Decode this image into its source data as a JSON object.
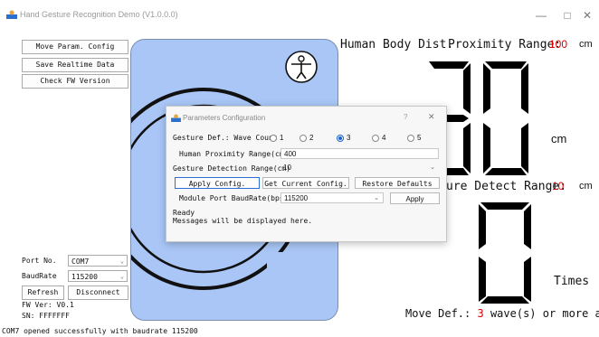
{
  "window": {
    "title": "Hand Gesture Recognition Demo (V1.0.0.0)",
    "minimize": "—",
    "maximize": "□",
    "close": "✕"
  },
  "left_panel": {
    "move_param_config": "Move Param. Config",
    "save_realtime_data": "Save Realtime Data",
    "check_fw_version": "Check FW Version",
    "port_label": "Port No.",
    "port_value": "COM7",
    "baud_label": "BaudRate",
    "baud_value": "115200",
    "refresh": "Refresh",
    "disconnect": "Disconnect",
    "fw_ver": "FW Ver: V0.1",
    "sn": "SN: FFFFFFF"
  },
  "right_panel": {
    "body_dist_label": "Human Body Dist.",
    "proximity_label": "Proximity Range:",
    "proximity_value": "100",
    "proximity_unit": "cm",
    "distance_value": "30",
    "distance_unit": "cm",
    "gesture_detect_label": "ure Detect Range:",
    "gesture_detect_value": "10",
    "gesture_detect_unit": "cm",
    "count_value": "0",
    "count_unit": "Times",
    "move_def_prefix": "Move Def.:",
    "move_def_value": "3",
    "move_def_suffix": "wave(s) or more as 1"
  },
  "dialog": {
    "title": "Parameters Configuration",
    "help": "?",
    "close": "✕",
    "gesture_def_label": "Gesture Def.: Wave Count",
    "radio_options": [
      "1",
      "2",
      "3",
      "4",
      "5"
    ],
    "selected": "3",
    "proximity_range_label": "Human Proximity Range(cm)",
    "proximity_range_value": "400",
    "detection_range_label": "Gesture Detection Range(cm)",
    "detection_range_value": "10",
    "apply_config": "Apply Config.",
    "get_current_config": "Get Current Config.",
    "restore_defaults": "Restore Defaults",
    "baud_label": "Module Port BaudRate(bps)",
    "baud_value": "115200",
    "apply": "Apply",
    "status_line1": "Ready",
    "status_line2": "Messages will be displayed here."
  },
  "statusbar": {
    "message": "COM7 opened successfully with baudrate 115200"
  },
  "colors": {
    "accent": "#1a5fd1",
    "image_panel": "#a9c6f6",
    "highlight_value": "#e00000"
  }
}
